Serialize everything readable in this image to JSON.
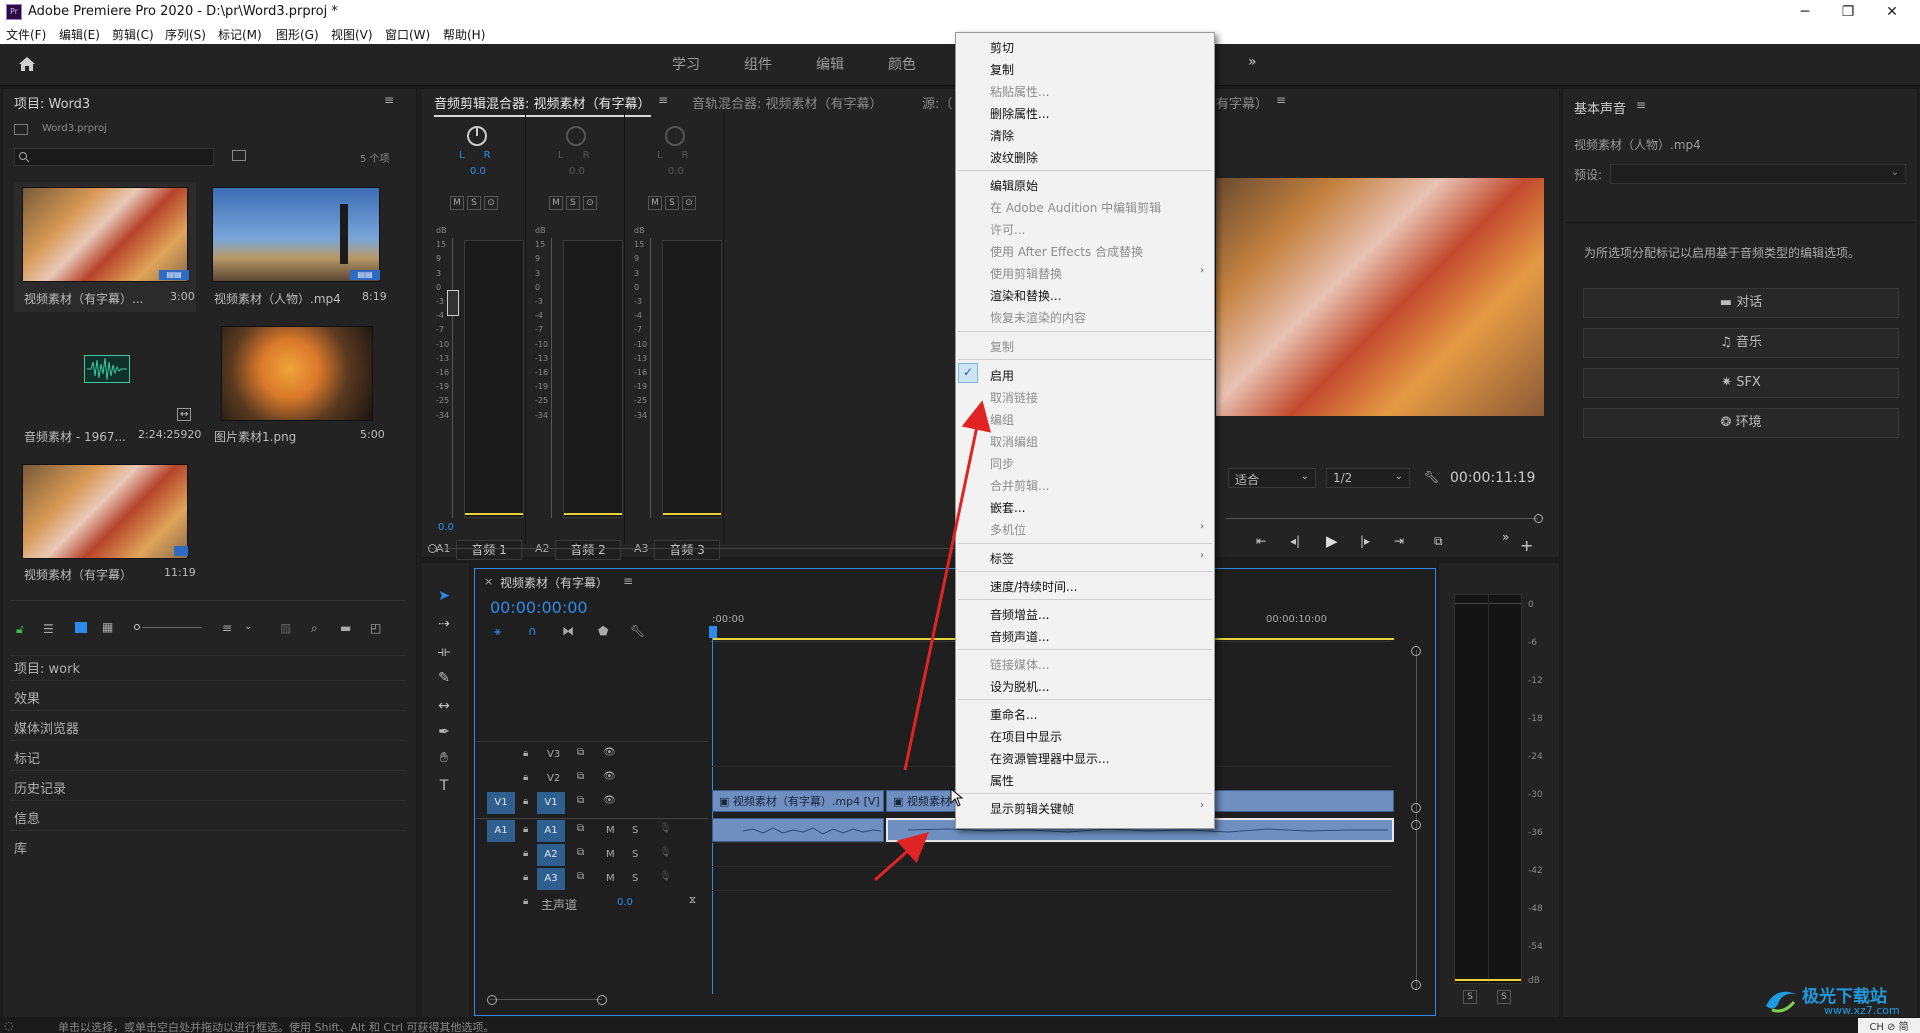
{
  "titlebar": {
    "app_title": "Adobe Premiere Pro 2020 - D:\\pr\\Word3.prproj *",
    "minimize": "─",
    "maximize": "❐",
    "close": "✕",
    "logo": "Pr"
  },
  "menubar": [
    "文件(F)",
    "编辑(E)",
    "剪辑(C)",
    "序列(S)",
    "标记(M)",
    "图形(G)",
    "视图(V)",
    "窗口(W)",
    "帮助(H)"
  ],
  "workspaces": [
    "学习",
    "组件",
    "编辑",
    "颜色"
  ],
  "project": {
    "title": "项目: Word3",
    "file": "Word3.prproj",
    "count": "5 个项",
    "items": [
      {
        "name": "视频素材（有字幕）...",
        "duration": "3:00"
      },
      {
        "name": "视频素材（人物）.mp4",
        "duration": "8:19"
      },
      {
        "name": "音频素材 - 1967...",
        "duration": "2:24:25920"
      },
      {
        "name": "图片素材1.png",
        "duration": "5:00"
      },
      {
        "name": "视频素材（有字幕）",
        "duration": "11:19"
      }
    ],
    "nav": [
      "项目: work",
      "效果",
      "媒体浏览器",
      "标记",
      "历史记录",
      "信息",
      "库"
    ]
  },
  "mixer": {
    "tabs": [
      "音频剪辑混合器: 视频素材（有字幕）",
      "音轨混合器: 视频素材（有字幕）",
      "源:（",
      "有字幕）"
    ],
    "lr": "L      R",
    "knob_val": "0.0",
    "db_scale": [
      "dB",
      "15",
      "9",
      "3",
      "0",
      "-3",
      "-4",
      "-7",
      "-10",
      "-13",
      "-16",
      "-19",
      "-25",
      "-34"
    ],
    "fader_val": "0.0",
    "channels": [
      {
        "id": "A1",
        "name": "音频 1"
      },
      {
        "id": "A2",
        "name": "音频 2"
      },
      {
        "id": "A3",
        "name": "音频 3"
      }
    ],
    "ms": [
      "M",
      "S",
      "⊙"
    ]
  },
  "monitor": {
    "fit": "适合",
    "res": "1/2",
    "timecode": "00:00:11:19"
  },
  "essential": {
    "title": "基本声音",
    "clip": "视频素材（人物）.mp4",
    "preset_label": "预设:",
    "hint": "为所选项分配标记以启用基于音频类型的编辑选项。",
    "buttons": [
      "对话",
      "音乐",
      "SFX",
      "环境"
    ]
  },
  "timeline": {
    "seq_name": "视频素材（有字幕）",
    "timecode": "00:00:00:00",
    "ruler": [
      ":00:00",
      "00:00:10:00"
    ],
    "video_tracks": [
      "V3",
      "V2",
      "V1"
    ],
    "audio_tracks": [
      "A1",
      "A2",
      "A3"
    ],
    "source_v": "V1",
    "source_a": "A1",
    "master": "主声道",
    "master_val": "0.0",
    "clip1": "视频素材（有字幕）.mp4 [V]",
    "clip2": "视频素材",
    "ms": [
      "M",
      "S"
    ]
  },
  "right_meter": {
    "ticks": [
      "0",
      "-6",
      "-12",
      "-18",
      "-24",
      "-30",
      "-36",
      "-42",
      "-48",
      "-54",
      "dB"
    ],
    "solo": [
      "S",
      "S"
    ]
  },
  "context_menu": {
    "items": [
      {
        "label": "剪切",
        "dis": false
      },
      {
        "label": "复制",
        "dis": false
      },
      {
        "label": "粘贴属性...",
        "dis": true
      },
      {
        "label": "删除属性...",
        "dis": false
      },
      {
        "label": "清除",
        "dis": false
      },
      {
        "label": "波纹删除",
        "dis": false
      },
      {
        "label": "编辑原始",
        "dis": false
      },
      {
        "label": "在 Adobe Audition 中编辑剪辑",
        "dis": true
      },
      {
        "label": "许可...",
        "dis": true
      },
      {
        "label": "使用 After Effects 合成替换",
        "dis": true
      },
      {
        "label": "使用剪辑替换",
        "dis": true
      },
      {
        "label": "渲染和替换...",
        "dis": false
      },
      {
        "label": "恢复未渲染的内容",
        "dis": true
      },
      {
        "label": "复制",
        "dis": true
      },
      {
        "label": "启用",
        "dis": false
      },
      {
        "label": "取消链接",
        "dis": true
      },
      {
        "label": "编组",
        "dis": true
      },
      {
        "label": "取消编组",
        "dis": true
      },
      {
        "label": "同步",
        "dis": true
      },
      {
        "label": "合并剪辑...",
        "dis": true
      },
      {
        "label": "嵌套...",
        "dis": false
      },
      {
        "label": "多机位",
        "dis": true
      },
      {
        "label": "标签",
        "dis": false
      },
      {
        "label": "速度/持续时间...",
        "dis": false
      },
      {
        "label": "音频增益...",
        "dis": false
      },
      {
        "label": "音频声道...",
        "dis": false
      },
      {
        "label": "链接媒体...",
        "dis": true
      },
      {
        "label": "设为脱机...",
        "dis": false
      },
      {
        "label": "重命名...",
        "dis": false
      },
      {
        "label": "在项目中显示",
        "dis": false
      },
      {
        "label": "在资源管理器中显示...",
        "dis": false
      },
      {
        "label": "属性",
        "dis": false
      },
      {
        "label": "显示剪辑关键帧",
        "dis": false
      }
    ],
    "arrow": "›",
    "check": "✓"
  },
  "statusbar": {
    "text": "单击以选择，或单击空白处并拖动以进行框选。使用 Shift、Alt 和 Ctrl 可获得其他选项。"
  },
  "watermark": {
    "brand": "极光下载站",
    "url": "www.xz7.com",
    "ime": "CH ⊘ 简"
  },
  "colors": {
    "accent": "#2d8ceb",
    "arrow": "#e02424",
    "clip": "#6e8fbf",
    "yellow": "#e6d23a"
  }
}
